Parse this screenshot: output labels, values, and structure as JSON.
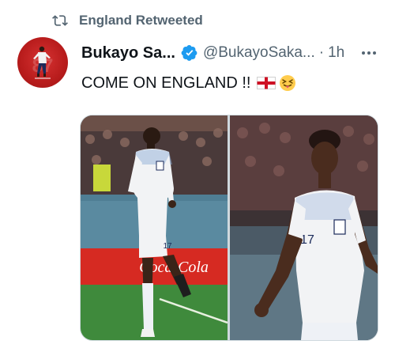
{
  "retweet": {
    "label": "England Retweeted",
    "icon": "retweet-icon"
  },
  "author": {
    "avatar_icon": "avatar-image",
    "display_name": "Bukayo Sa...",
    "verified_icon": "verified-badge-icon",
    "handle": "@BukayoSaka...",
    "separator": "·",
    "time": "1h"
  },
  "tweet": {
    "text": "COME ON ENGLAND !!",
    "flag_icon": "england-flag-emoji",
    "emoji_icon": "tongue-wink-emoji"
  },
  "media": {
    "photos": [
      {
        "name": "celebration-photo-1",
        "shirt_number": "17",
        "banner_text": "Coca-Cola"
      },
      {
        "name": "celebration-photo-2",
        "shirt_number": "17"
      }
    ]
  },
  "colors": {
    "text_primary": "#0f1419",
    "text_secondary": "#536471",
    "verified_blue": "#1d9bf0",
    "england_red": "#ce1124"
  }
}
